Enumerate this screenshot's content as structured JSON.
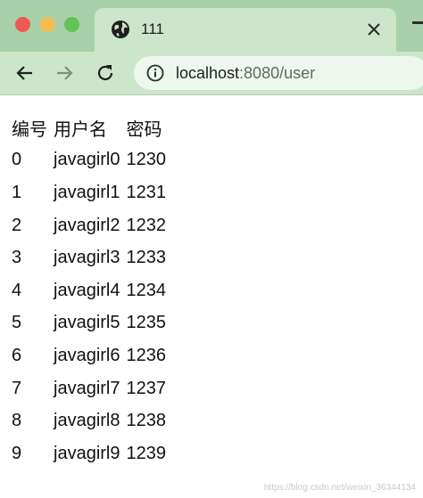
{
  "tab": {
    "title": "111",
    "icon": "globe-icon",
    "close_icon": "close-icon"
  },
  "toolbar": {
    "back_icon": "back-arrow-icon",
    "forward_icon": "forward-arrow-icon",
    "reload_icon": "reload-icon",
    "address": {
      "host": "localhost",
      "rest": ":8080/user",
      "info_icon": "info-icon"
    }
  },
  "table": {
    "headers": [
      "编号",
      "用户名",
      "密码"
    ],
    "rows": [
      [
        "0",
        "javagirl0",
        "1230"
      ],
      [
        "1",
        "javagirl1",
        "1231"
      ],
      [
        "2",
        "javagirl2",
        "1232"
      ],
      [
        "3",
        "javagirl3",
        "1233"
      ],
      [
        "4",
        "javagirl4",
        "1234"
      ],
      [
        "5",
        "javagirl5",
        "1235"
      ],
      [
        "6",
        "javagirl6",
        "1236"
      ],
      [
        "7",
        "javagirl7",
        "1237"
      ],
      [
        "8",
        "javagirl8",
        "1238"
      ],
      [
        "9",
        "javagirl9",
        "1239"
      ]
    ]
  },
  "watermark": "https://blog.csdn.net/weixin_36344134",
  "colors": {
    "tabstrip": "#a9d1a9",
    "active_tab": "#cbe6cb",
    "omnibox": "#eef7ee",
    "close_red": "#ee5a52",
    "minimize_yellow": "#f5be4f",
    "zoom_green": "#61c454"
  }
}
